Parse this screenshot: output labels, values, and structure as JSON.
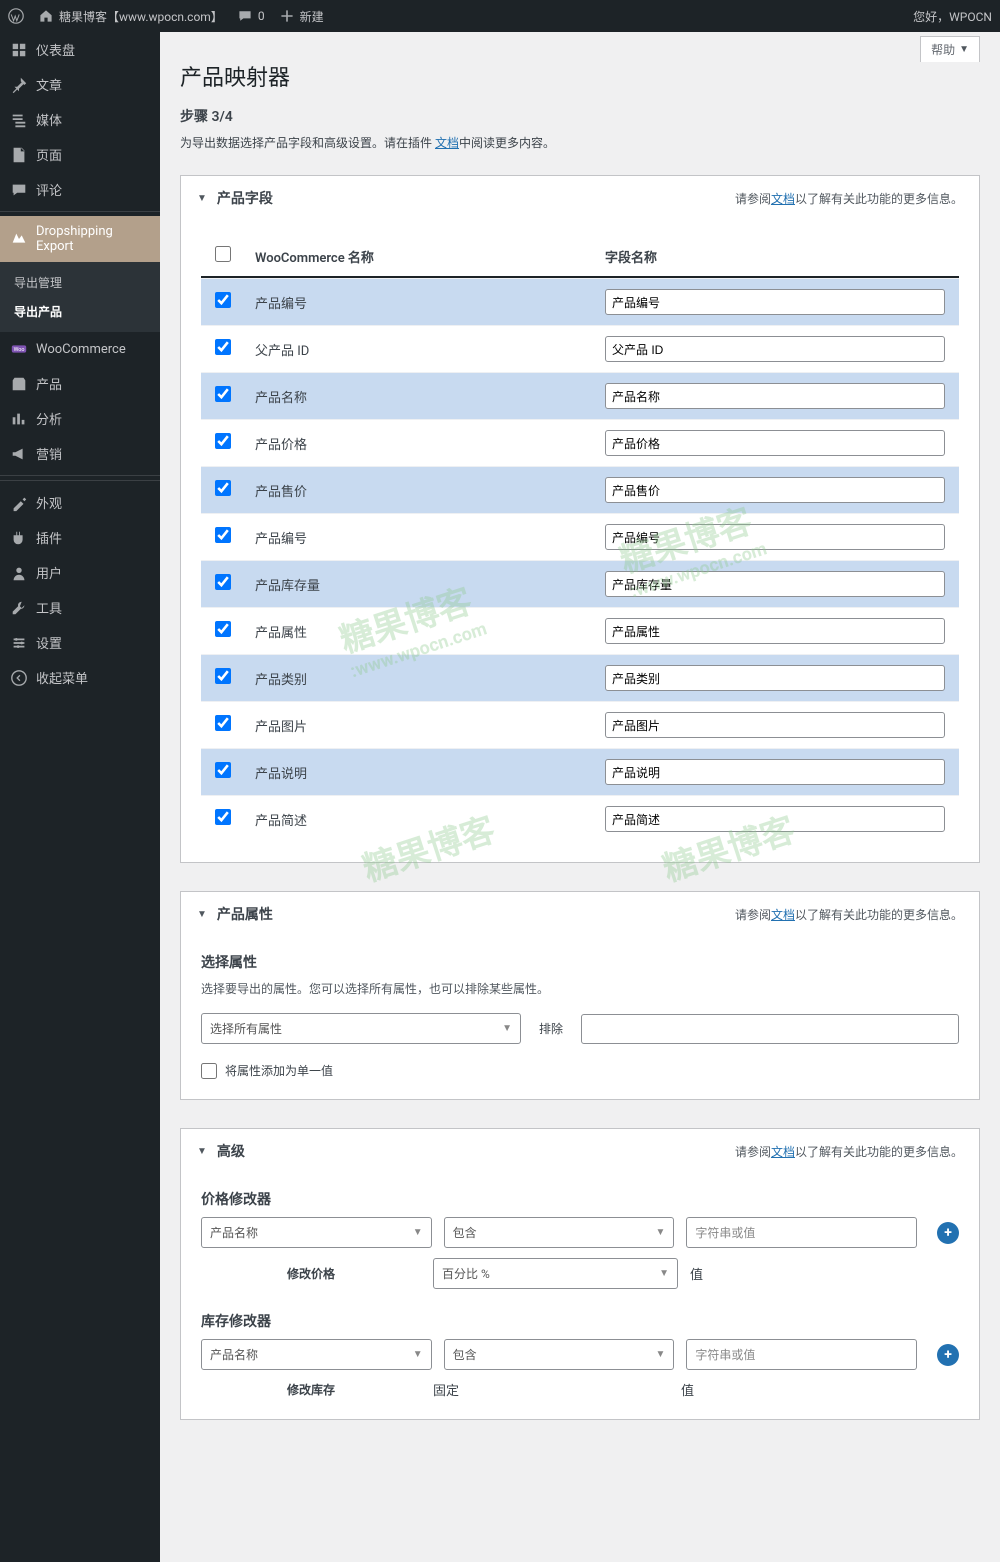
{
  "adminbar": {
    "site_name": "糖果博客【www.wpocn.com】",
    "comments": "0",
    "new": "新建",
    "greeting": "您好，WPOCN"
  },
  "sidebar": {
    "items": [
      {
        "icon": "dashboard",
        "label": "仪表盘"
      },
      {
        "icon": "pin",
        "label": "文章"
      },
      {
        "icon": "media",
        "label": "媒体"
      },
      {
        "icon": "page",
        "label": "页面"
      },
      {
        "icon": "comment",
        "label": "评论"
      },
      {
        "icon": "dropship",
        "label": "Dropshipping Export",
        "active": true,
        "sub": [
          {
            "label": "导出管理"
          },
          {
            "label": "导出产品",
            "current": true
          }
        ]
      },
      {
        "icon": "woo",
        "label": "WooCommerce"
      },
      {
        "icon": "product",
        "label": "产品"
      },
      {
        "icon": "analytics",
        "label": "分析"
      },
      {
        "icon": "marketing",
        "label": "营销"
      },
      {
        "icon": "appearance",
        "label": "外观"
      },
      {
        "icon": "plugin",
        "label": "插件"
      },
      {
        "icon": "user",
        "label": "用户"
      },
      {
        "icon": "tool",
        "label": "工具"
      },
      {
        "icon": "settings",
        "label": "设置"
      },
      {
        "icon": "collapse",
        "label": "收起菜单"
      }
    ]
  },
  "help": "帮助",
  "page_title": "产品映射器",
  "step": "步骤 3/4",
  "desc_pre": "为导出数据选择产品字段和高级设置。请在插件 ",
  "desc_link": "文档",
  "desc_post": "中阅读更多内容。",
  "panel_note_pre": "请参阅",
  "panel_note_link": "文档",
  "panel_note_post": "以了解有关此功能的更多信息。",
  "fields_panel": {
    "title": "产品字段",
    "col_woo": "WooCommerce 名称",
    "col_field": "字段名称",
    "rows": [
      {
        "checked": true,
        "name": "产品编号",
        "value": "产品编号"
      },
      {
        "checked": true,
        "name": "父产品 ID",
        "value": "父产品 ID"
      },
      {
        "checked": true,
        "name": "产品名称",
        "value": "产品名称"
      },
      {
        "checked": true,
        "name": "产品价格",
        "value": "产品价格"
      },
      {
        "checked": true,
        "name": "产品售价",
        "value": "产品售价"
      },
      {
        "checked": true,
        "name": "产品编号",
        "value": "产品编号"
      },
      {
        "checked": true,
        "name": "产品库存量",
        "value": "产品库存量"
      },
      {
        "checked": true,
        "name": "产品属性",
        "value": "产品属性"
      },
      {
        "checked": true,
        "name": "产品类别",
        "value": "产品类别"
      },
      {
        "checked": true,
        "name": "产品图片",
        "value": "产品图片"
      },
      {
        "checked": true,
        "name": "产品说明",
        "value": "产品说明"
      },
      {
        "checked": true,
        "name": "产品简述",
        "value": "产品简述"
      }
    ]
  },
  "attr_panel": {
    "title": "产品属性",
    "sub": "选择属性",
    "hint": "选择要导出的属性。您可以选择所有属性，也可以排除某些属性。",
    "select_all": "选择所有属性",
    "exclude": "排除",
    "single": "将属性添加为单一值"
  },
  "adv_panel": {
    "title": "高级",
    "price_mod": "价格修改器",
    "stock_mod": "库存修改器",
    "mod_price": "修改价格",
    "mod_stock": "修改库存",
    "product_name": "产品名称",
    "contains": "包含",
    "str_or_val": "字符串或值",
    "percent": "百分比 %",
    "fixed": "固定",
    "value": "值"
  },
  "watermark": {
    "main": "糖果博客",
    "sub": ":www.wpocn.com"
  }
}
